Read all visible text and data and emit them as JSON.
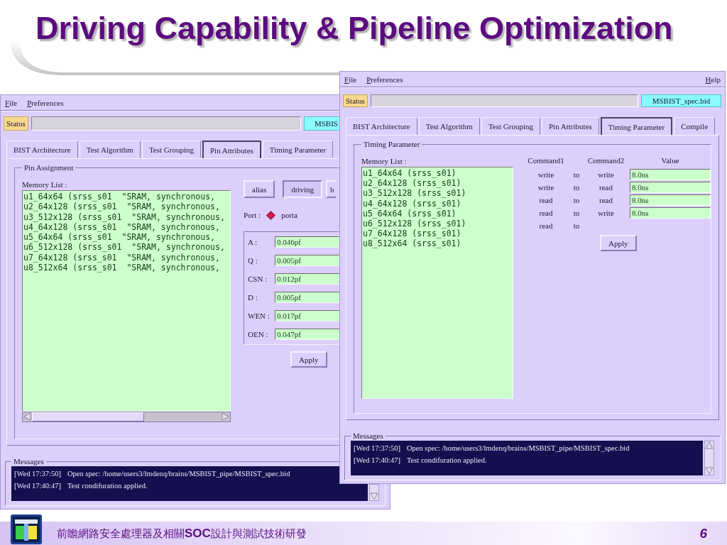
{
  "slide_title": "Driving Capability & Pipeline Optimization",
  "windows": [
    {
      "kind": "pin_attributes",
      "menu": [
        "File",
        "Preferences"
      ],
      "status_label": "Status",
      "file_label": "MSBIS",
      "tabs": [
        {
          "label": "BIST Architecture",
          "selected": false
        },
        {
          "label": "Test Algorithm",
          "selected": false
        },
        {
          "label": "Test Grouping",
          "selected": false
        },
        {
          "label": "Pin Attributes",
          "selected": true
        },
        {
          "label": "Timing Parameter",
          "selected": false
        }
      ],
      "group_title": "Pin Assignment",
      "memory_list_label": "Memory List :",
      "memory_list": [
        "u1_64x64 (srss_s01  \"SRAM, synchronous,",
        "u2_64x128 (srss_s01  \"SRAM, synchronous,",
        "u3_512x128 (srss_s01  \"SRAM, synchronous,",
        "u4_64x128 (srss_s01  \"SRAM, synchronous,",
        "u5_64x64 (srss_s01  \"SRAM, synchronous,",
        "u6_512x128 (srss_s01  \"SRAM, synchronous,",
        "u7_64x128 (srss_s01  \"SRAM, synchronous,",
        "u8_512x64 (srss_s01  \"SRAM, synchronous,"
      ],
      "mode_buttons": [
        {
          "label": "alias",
          "selected": false
        },
        {
          "label": "driving",
          "selected": true
        },
        {
          "label": "h",
          "selected": false
        }
      ],
      "port_label": "Port :",
      "port_option": {
        "label": "porta",
        "selected": true
      },
      "pins": [
        {
          "label": "A :",
          "value": "0.046pf"
        },
        {
          "label": "Q :",
          "value": "0.005pf"
        },
        {
          "label": "CSN :",
          "value": "0.012pf"
        },
        {
          "label": "D :",
          "value": "0.005pf"
        },
        {
          "label": "WEN :",
          "value": "0.017pf"
        },
        {
          "label": "OEN :",
          "value": "0.047pf"
        }
      ],
      "apply": "Apply",
      "messages_title": "Messages",
      "messages": [
        {
          "time": "[Wed 17:37:50]",
          "text": "Open spec: /home/users3/lmdenq/brains/MSBIST_pipe/MSBIST_spec.bid"
        },
        {
          "time": "[Wed 17:40:47]",
          "text": "Test condifuration applied."
        }
      ]
    },
    {
      "kind": "timing_parameter",
      "menu": [
        "File",
        "Preferences"
      ],
      "help": "Help",
      "status_label": "Status",
      "file_label": "MSBIST_spec.bid",
      "tabs": [
        {
          "label": "BIST Architecture",
          "selected": false
        },
        {
          "label": "Test Algorithm",
          "selected": false
        },
        {
          "label": "Test Grouping",
          "selected": false
        },
        {
          "label": "Pin Attributes",
          "selected": false
        },
        {
          "label": "Timing Parameter",
          "selected": true
        },
        {
          "label": "Compile",
          "selected": false
        }
      ],
      "group_title": "Timing Parameter",
      "memory_list_label": "Memory List :",
      "memory_list": [
        "u1_64x64 (srss_s01)",
        "u2_64x128 (srss_s01)",
        "u3_512x128 (srss_s01)",
        "u4_64x128 (srss_s01)",
        "u5_64x64 (srss_s01)",
        "u6_512x128 (srss_s01)",
        "u7_64x128 (srss_s01)",
        "u8_512x64 (srss_s01)"
      ],
      "columns": [
        "Command1",
        "Command2",
        "Value"
      ],
      "rows": [
        {
          "command1": "write",
          "to": "to",
          "command2": "write",
          "value": "8.0ns"
        },
        {
          "command1": "write",
          "to": "to",
          "command2": "read",
          "value": "8.0ns"
        },
        {
          "command1": "read",
          "to": "to",
          "command2": "read",
          "value": "8.0ns"
        },
        {
          "command1": "read",
          "to": "to",
          "command2": "write",
          "value": "8.0ns"
        },
        {
          "command1": "read",
          "to": "to"
        }
      ],
      "apply": "Apply",
      "messages_title": "Messages",
      "messages": [
        {
          "time": "[Wed 17:37:50]",
          "text": "Open spec: /home/users3/lmdenq/brains/MSBIST_pipe/MSBIST_spec.bid"
        },
        {
          "time": "[Wed 17:40:47]",
          "text": "Test condifuration applied."
        }
      ]
    }
  ],
  "footer": {
    "text": "前瞻網路安全處理器及相關**SOC**設計與測試技術研發",
    "page_number": "6"
  }
}
